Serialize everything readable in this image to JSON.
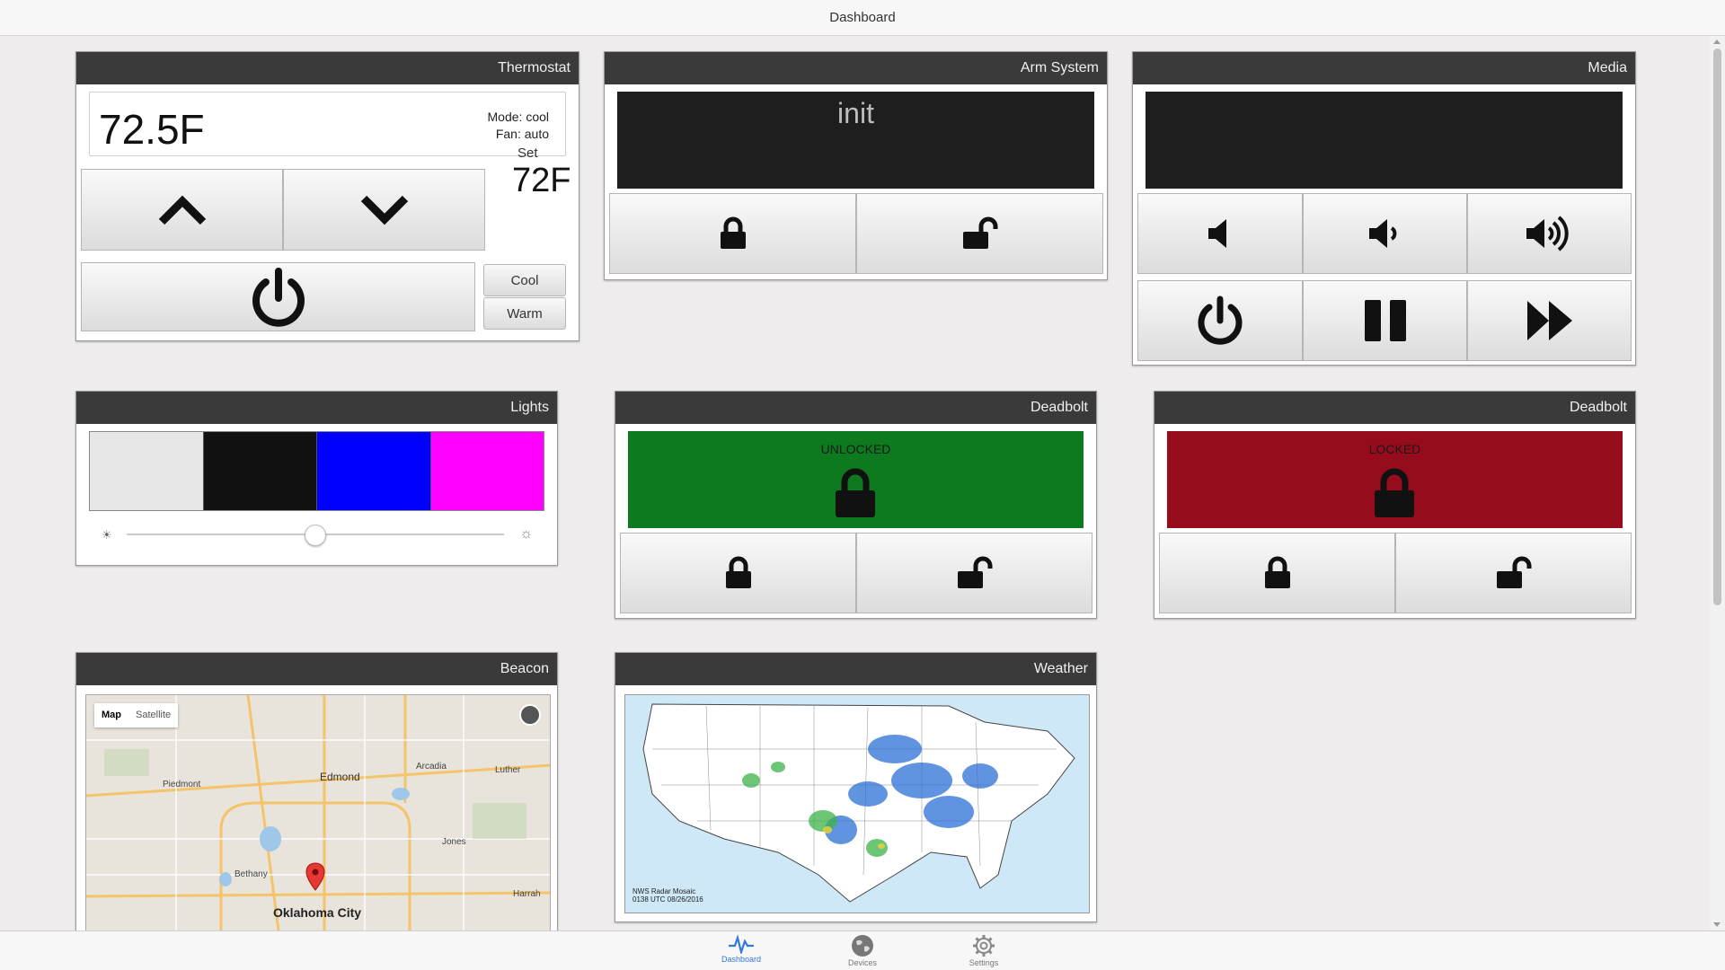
{
  "header": {
    "title": "Dashboard"
  },
  "colors": {
    "accent": "#3478d8",
    "unlocked": "#0d7a1e",
    "locked": "#970c1c",
    "panel_header": "#3a3a3a"
  },
  "thermostat": {
    "title": "Thermostat",
    "current_temp": "72.5F",
    "mode": "Mode: cool",
    "fan": "Fan: auto",
    "set_label": "Set",
    "set_temp": "72F",
    "cool_label": "Cool",
    "warm_label": "Warm"
  },
  "arm_system": {
    "title": "Arm System",
    "status": "init"
  },
  "media": {
    "title": "Media"
  },
  "lights": {
    "title": "Lights",
    "swatches": [
      "#e6e6e6",
      "#111111",
      "#0000ff",
      "#ff00ff"
    ],
    "brightness": 0.5
  },
  "deadbolt_1": {
    "title": "Deadbolt",
    "status": "UNLOCKED"
  },
  "deadbolt_2": {
    "title": "Deadbolt",
    "status": "LOCKED"
  },
  "beacon": {
    "title": "Beacon",
    "map_tab": "Map",
    "satellite_tab": "Satellite",
    "places": {
      "edmond": "Edmond",
      "arcadia": "Arcadia",
      "luther": "Luther",
      "piedmont": "Piedmont",
      "jones": "Jones",
      "bethany": "Bethany",
      "okc": "Oklahoma City",
      "harrah": "Harrah"
    }
  },
  "weather": {
    "title": "Weather",
    "caption_line1": "NWS Radar Mosaic",
    "caption_line2": "0138 UTC 08/26/2016"
  },
  "tabs": [
    {
      "label": "Dashboard",
      "icon": "pulse-icon"
    },
    {
      "label": "Devices",
      "icon": "globe-icon"
    },
    {
      "label": "Settings",
      "icon": "gear-icon"
    }
  ]
}
